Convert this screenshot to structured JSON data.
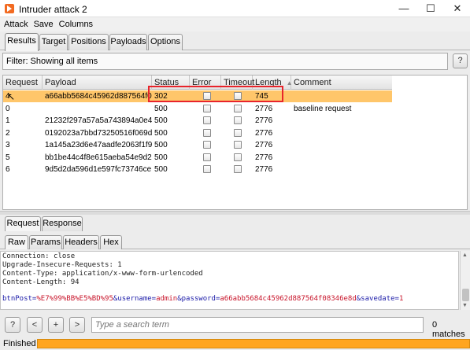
{
  "window": {
    "title": "Intruder attack 2"
  },
  "menu": [
    "Attack",
    "Save",
    "Columns"
  ],
  "tabs": [
    "Results",
    "Target",
    "Positions",
    "Payloads",
    "Options"
  ],
  "filter": {
    "text": "Filter: Showing all items",
    "help": "?"
  },
  "table": {
    "columns": [
      "Request",
      "Payload",
      "Status",
      "Error",
      "Timeout",
      "Length",
      "Comment"
    ],
    "rows": [
      {
        "request": "4",
        "payload": "a66abb5684c45962d887564f0...",
        "status": "302",
        "length": "745",
        "comment": ""
      },
      {
        "request": "0",
        "payload": "",
        "status": "500",
        "length": "2776",
        "comment": "baseline request"
      },
      {
        "request": "1",
        "payload": "21232f297a57a5a743894a0e4...",
        "status": "500",
        "length": "2776",
        "comment": ""
      },
      {
        "request": "2",
        "payload": "0192023a7bbd73250516f069d...",
        "status": "500",
        "length": "2776",
        "comment": ""
      },
      {
        "request": "3",
        "payload": "1a145a23d6e47aadfe2063f1f9...",
        "status": "500",
        "length": "2776",
        "comment": ""
      },
      {
        "request": "5",
        "payload": "bb1be44c4f8e615aeba54e9d2...",
        "status": "500",
        "length": "2776",
        "comment": ""
      },
      {
        "request": "6",
        "payload": "9d5d2da596d1e597fc73746ce...",
        "status": "500",
        "length": "2776",
        "comment": ""
      }
    ]
  },
  "subtabs": [
    "Request",
    "Response"
  ],
  "viewtabs": [
    "Raw",
    "Params",
    "Headers",
    "Hex"
  ],
  "editor": {
    "lines": [
      "Connection: close",
      "Upgrade-Insecure-Requests: 1",
      "Content-Type: application/x-www-form-urlencoded",
      "Content-Length: 94"
    ],
    "body_prefix": "btnPost=",
    "body_btn_val": "%E7%99%BB%E5%BD%95",
    "body_user_key": "&username=",
    "body_user_val": "admin",
    "body_pass_key": "&password=",
    "body_pass_val": "a66abb5684c45962d887564f08346e8d",
    "body_save_key": "&savedate=",
    "body_save_val": "1"
  },
  "search": {
    "placeholder": "Type a search term",
    "matches": "0 matches",
    "buttons": [
      "?",
      "<",
      "+",
      ">"
    ]
  },
  "status": {
    "text": "Finished",
    "progress": 1.0
  },
  "colors": {
    "selected_row": "#ffc66a",
    "progress": "#ffa51f",
    "highlight": "#e8242b"
  }
}
